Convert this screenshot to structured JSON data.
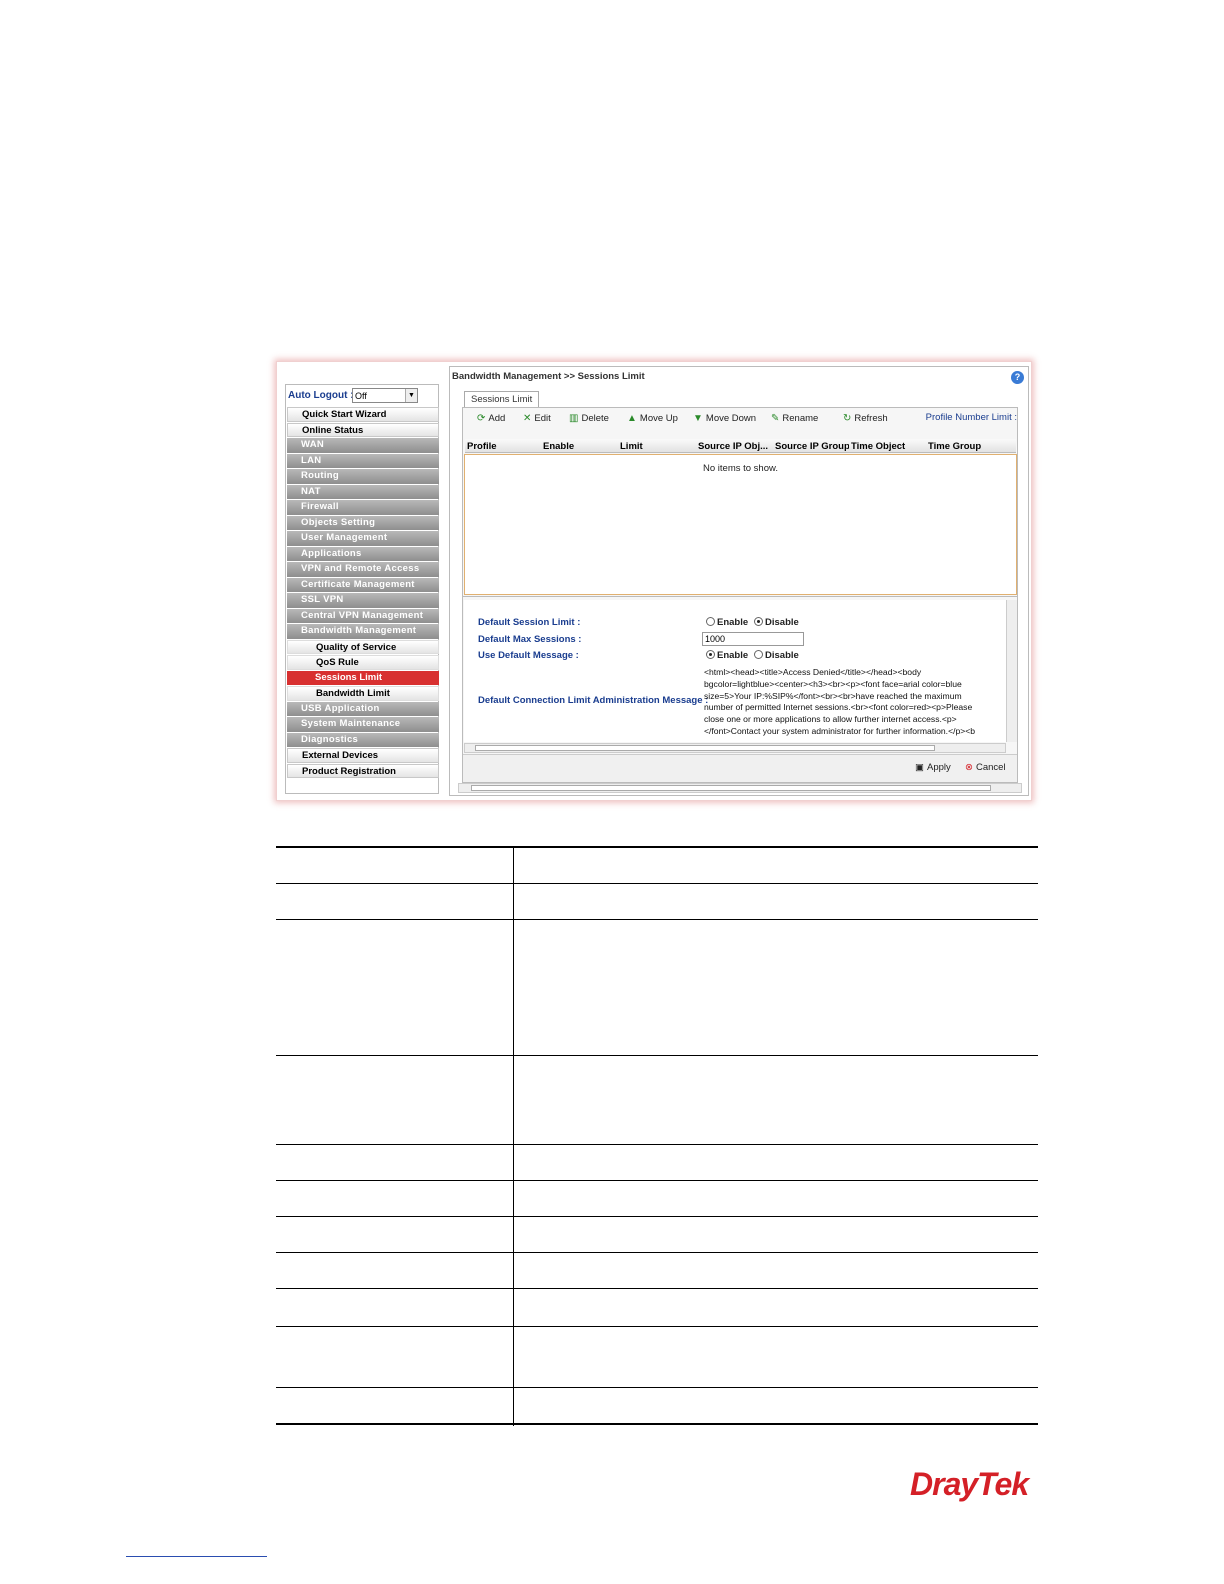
{
  "screenshot": {
    "auto_logout": {
      "label": "Auto Logout :",
      "value": "Off"
    },
    "menu": [
      {
        "label": "Quick Start Wizard",
        "style": "white"
      },
      {
        "label": "Online Status",
        "style": "white"
      },
      {
        "label": "WAN",
        "style": "gray"
      },
      {
        "label": "LAN",
        "style": "gray"
      },
      {
        "label": "Routing",
        "style": "gray"
      },
      {
        "label": "NAT",
        "style": "gray"
      },
      {
        "label": "Firewall",
        "style": "gray"
      },
      {
        "label": "Objects Setting",
        "style": "gray"
      },
      {
        "label": "User Management",
        "style": "gray"
      },
      {
        "label": "Applications",
        "style": "gray"
      },
      {
        "label": "VPN and Remote Access",
        "style": "gray"
      },
      {
        "label": "Certificate Management",
        "style": "gray"
      },
      {
        "label": "SSL VPN",
        "style": "gray"
      },
      {
        "label": "Central VPN Management",
        "style": "gray"
      },
      {
        "label": "Bandwidth Management",
        "style": "gray"
      },
      {
        "label": "Quality of Service",
        "style": "sub"
      },
      {
        "label": "QoS Rule",
        "style": "sub"
      },
      {
        "label": "Sessions Limit",
        "style": "active"
      },
      {
        "label": "Bandwidth Limit",
        "style": "sub"
      },
      {
        "label": "USB Application",
        "style": "gray"
      },
      {
        "label": "System Maintenance",
        "style": "gray"
      },
      {
        "label": "Diagnostics",
        "style": "gray"
      },
      {
        "label": "External Devices",
        "style": "white"
      },
      {
        "label": "Product Registration",
        "style": "white"
      }
    ],
    "breadcrumb": "Bandwidth Management >> Sessions Limit",
    "tab": "Sessions Limit",
    "toolbar": {
      "add": "Add",
      "edit": "Edit",
      "delete": "Delete",
      "move_up": "Move Up",
      "move_down": "Move Down",
      "rename": "Rename",
      "refresh": "Refresh",
      "profile_limit": "Profile Number Limit :"
    },
    "grid_columns": [
      "Profile",
      "Enable",
      "Limit",
      "Source IP Obj...",
      "Source IP Group",
      "Time Object",
      "Time Group"
    ],
    "empty_text": "No items to show.",
    "form": {
      "session_limit_label": "Default Session Limit :",
      "max_sessions_label": "Default Max Sessions :",
      "max_sessions_value": "1000",
      "use_msg_label": "Use Default Message :",
      "admin_msg_label": "Default Connection Limit Administration Message :",
      "enable": "Enable",
      "disable": "Disable",
      "admin_msg_lines": [
        "<html><head><title>Access Denied</title></head><body",
        "bgcolor=lightblue><center><h3><br><p><font face=arial color=blue",
        "size=5>Your IP:%SIP%</font><br><br>have reached the maximum",
        "number of permitted Internet sessions.<br><font color=red><p>Please",
        "close one or more applications to allow further internet access.<p>",
        "</font>Contact your system administrator for further information.</p><b"
      ]
    },
    "footer": {
      "apply": "Apply",
      "cancel": "Cancel"
    }
  },
  "brand": {
    "logo": "DrayTek",
    "color": "#d42027"
  }
}
